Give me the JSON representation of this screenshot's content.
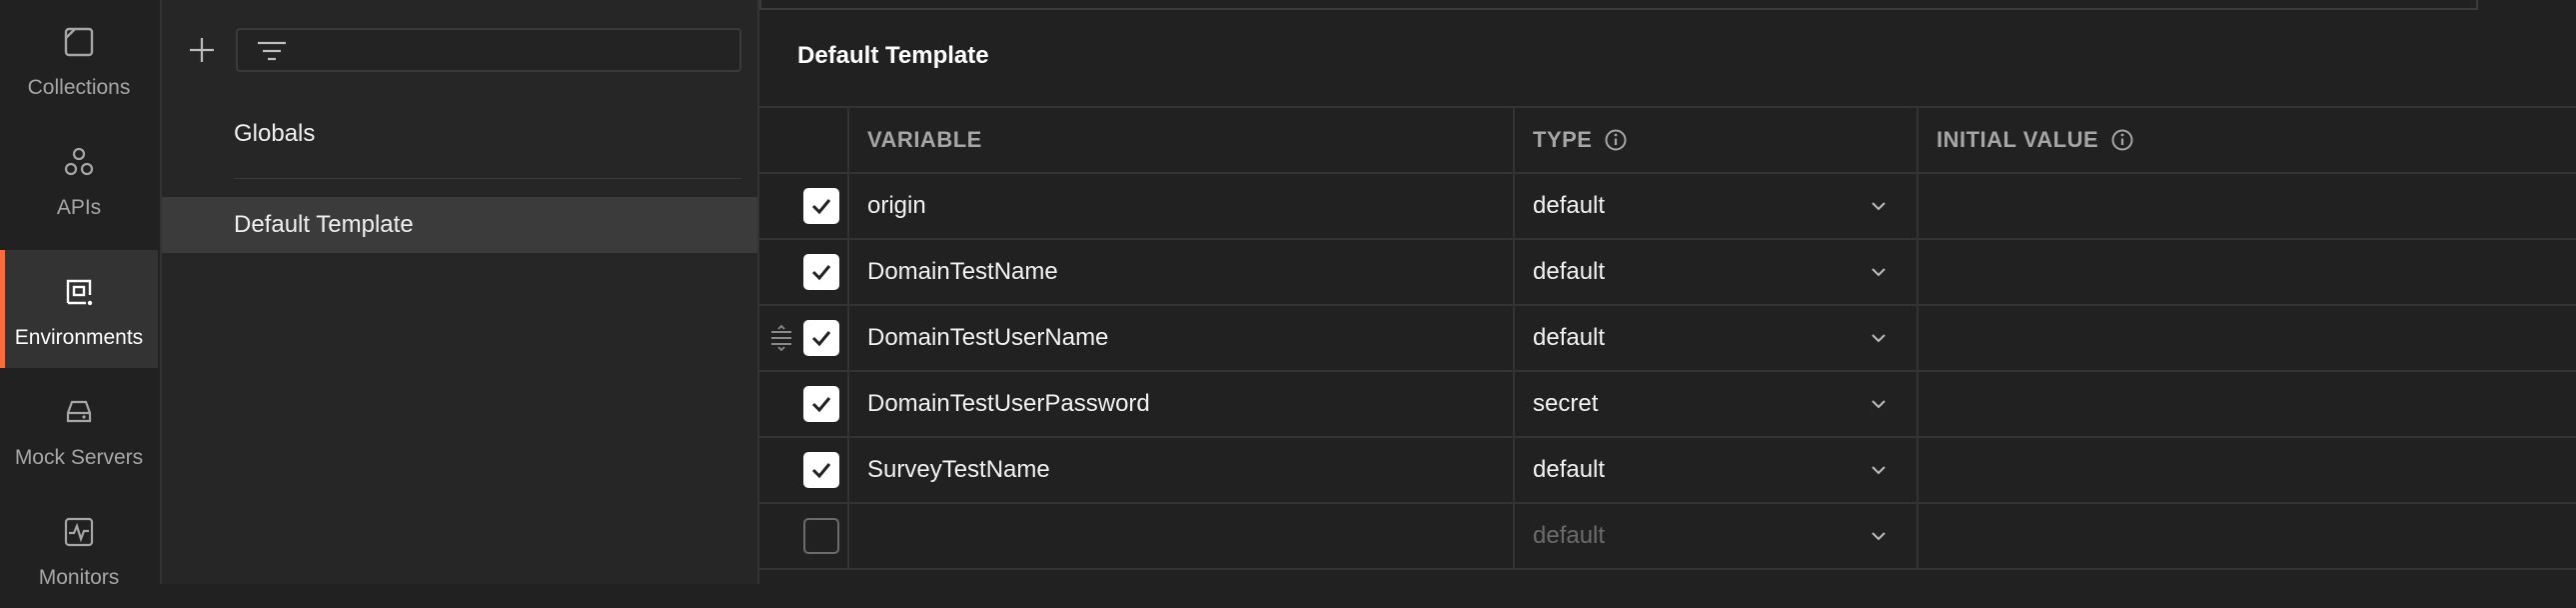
{
  "rail": {
    "items": [
      {
        "label": "Collections",
        "icon": "collections-icon",
        "active": false
      },
      {
        "label": "APIs",
        "icon": "apis-icon",
        "active": false
      },
      {
        "label": "Environments",
        "icon": "environments-icon",
        "active": true
      },
      {
        "label": "Mock Servers",
        "icon": "mock-servers-icon",
        "active": false
      },
      {
        "label": "Monitors",
        "icon": "monitors-icon",
        "active": false
      }
    ]
  },
  "sidebar": {
    "items": [
      {
        "label": "Globals"
      },
      {
        "label": "Default Template",
        "selected": true
      }
    ]
  },
  "environment": {
    "title": "Default Template",
    "columns": {
      "variable": "VARIABLE",
      "type": "TYPE",
      "initial_value": "INITIAL VALUE"
    },
    "rows": [
      {
        "checked": true,
        "variable": "origin",
        "type": "default"
      },
      {
        "checked": true,
        "variable": "DomainTestName",
        "type": "default"
      },
      {
        "checked": true,
        "variable": "DomainTestUserName",
        "type": "default"
      },
      {
        "checked": true,
        "variable": "DomainTestUserPassword",
        "type": "secret"
      },
      {
        "checked": true,
        "variable": "SurveyTestName",
        "type": "default"
      },
      {
        "checked": false,
        "variable": "",
        "type_placeholder": "default"
      }
    ]
  },
  "colors": {
    "accent": "#ff6c37",
    "background": "#212121"
  }
}
